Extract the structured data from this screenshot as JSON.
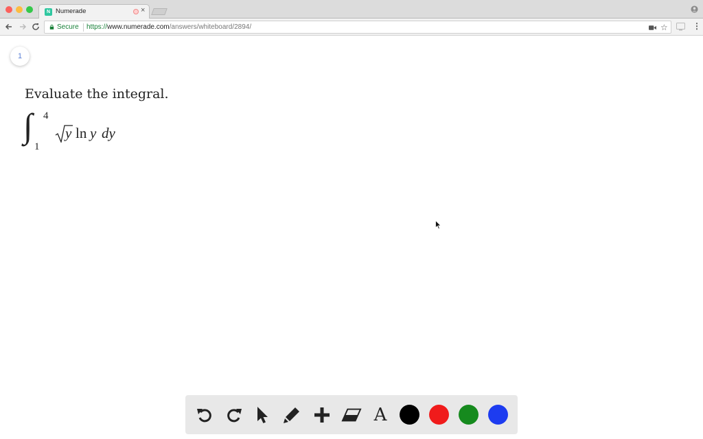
{
  "browser": {
    "tab_title": "Numerade",
    "favicon_letter": "N",
    "address": {
      "secure_label": "Secure",
      "scheme": "https://",
      "host": "www.numerade.com",
      "path": "/answers/whiteboard/2894/"
    },
    "icons": [
      "back-icon",
      "forward-icon",
      "reload-icon",
      "lock-icon",
      "camera-icon",
      "star-icon",
      "cast-icon",
      "menu-icon",
      "profile-icon"
    ]
  },
  "whiteboard": {
    "page_number": "1",
    "question": "Evaluate the integral.",
    "integral": {
      "sign": "∫",
      "upper_limit": "4",
      "lower_limit": "1",
      "radicand": "y",
      "function": "ln",
      "variable": "y",
      "differential": "dy"
    }
  },
  "drawing_toolbar": {
    "tools": [
      "undo-icon",
      "redo-icon",
      "select-icon",
      "pen-icon",
      "add-icon",
      "eraser-icon",
      "text-icon"
    ],
    "text_tool_label": "A",
    "colors": [
      {
        "name": "black",
        "hex": "#000000"
      },
      {
        "name": "red",
        "hex": "#f01b1b"
      },
      {
        "name": "green",
        "hex": "#168a1e"
      },
      {
        "name": "blue",
        "hex": "#1d3cf0"
      }
    ]
  }
}
